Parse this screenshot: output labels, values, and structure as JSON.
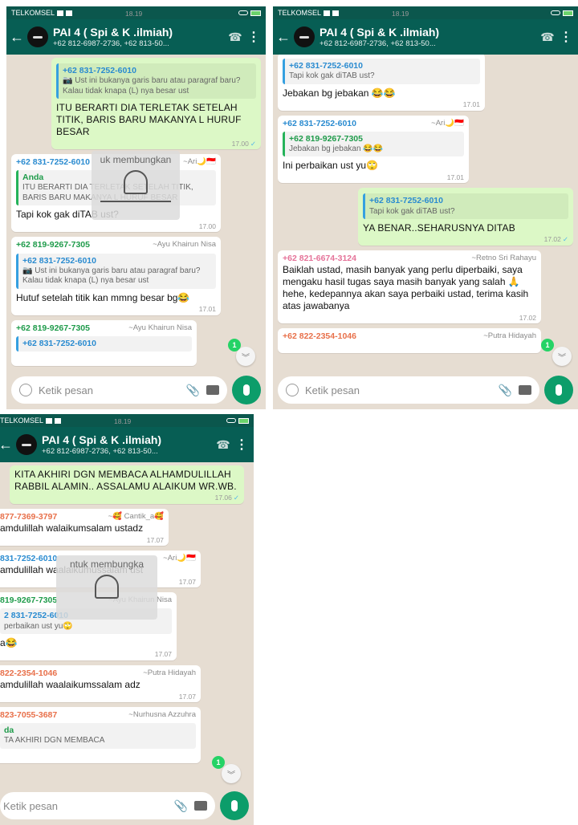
{
  "status": {
    "carrier": "TELKOMSEL",
    "time": "18.19"
  },
  "header": {
    "title": "PAI 4 ( Spi & K .ilmiah)",
    "subtitle": "+62 812-6987-2736, +62 813-50..."
  },
  "input": {
    "placeholder": "Ketik pesan"
  },
  "overlay": {
    "text1": "uk membungkan",
    "text3": "ntuk membungka"
  },
  "badges": {
    "unread": "1"
  },
  "p1": [
    {
      "name": "+62 831-7252-6010",
      "quote": "📷 Ust ini bukanya garis baru atau paragraf baru? Kalau tidak knapa (L) nya besar ust",
      "text": "ITU BERARTI DIA TERLETAK SETELAH TITIK, BARIS BARU MAKANYA L HURUF BESAR",
      "time": "17.00"
    },
    {
      "sender": "+62 831-7252-6010",
      "alias": "~Ari🌙🇮🇩",
      "qname": "Anda",
      "quote": "ITU BERARTI DIA TERLETAK SETELAH TITIK, BARIS BARU MAKANYA L HURUF BESAR",
      "text": "Tapi kok gak diTAB ust?",
      "time": "17.00"
    },
    {
      "sender": "+62 819-9267-7305",
      "alias": "~Ayu Khairun Nisa",
      "qname": "+62 831-7252-6010",
      "quote": "📷 Ust ini bukanya garis baru atau paragraf baru? Kalau tidak knapa (L) nya besar ust",
      "text": "Hutuf setelah titik kan mmng besar bg😂",
      "time": "17.01"
    },
    {
      "sender": "+62 819-9267-7305",
      "alias": "~Ayu Khairun Nisa",
      "qname": "+62 831-7252-6010"
    }
  ],
  "p2": [
    {
      "qname": "+62 831-7252-6010",
      "quote": "Tapi kok gak diTAB ust?",
      "text": "Jebakan bg jebakan 😂😂",
      "time": "17.01"
    },
    {
      "sender": "+62 831-7252-6010",
      "alias": "~Ari🌙🇮🇩",
      "qname": "+62 819-9267-7305",
      "quote": "Jebakan bg jebakan 😂😂",
      "text": "Ini perbaikan ust yu🙄",
      "time": "17.01"
    },
    {
      "qname": "+62 831-7252-6010",
      "quote": "Tapi kok gak diTAB ust?",
      "text": "YA BENAR..SEHARUSNYA DITAB",
      "time": "17.02"
    },
    {
      "sender": "+62 821-6674-3124",
      "alias": "~Retno Sri Rahayu",
      "text": "Baiklah ustad, masih banyak yang perlu diperbaiki, saya mengaku hasil tugas saya masih banyak yang salah 🙏 hehe, kedepannya akan saya perbaiki ustad, terima kasih atas jawabanya",
      "time": "17.02"
    },
    {
      "sender": "+62 822-2354-1046",
      "alias": "~Putra Hidayah"
    }
  ],
  "p3": [
    {
      "text": "KITA AKHIRI DGN MEMBACA ALHAMDULILLAH RABBIL ALAMIN.. ASSALAMU ALAIKUM WR.WB.",
      "time": "17.06"
    },
    {
      "sender": "877-7369-3797",
      "alias": "~🥰 Cantik_a🥰",
      "text": "amdulillah walaikumsalam ustadz",
      "time": "17.07"
    },
    {
      "sender": "831-7252-6010",
      "alias": "~Ari🌙🇮🇩",
      "text": "amdulillah waalaikumussalam ust",
      "time": "17.07"
    },
    {
      "sender": "819-9267-7305",
      "alias": "~Ayu Khairun Nisa",
      "qname": "2 831-7252-6010",
      "quote": "perbaikan ust yu🙄",
      "text": "a😂",
      "time": "17.07"
    },
    {
      "sender": "822-2354-1046",
      "alias": "~Putra Hidayah",
      "text": "amdulillah waalaikumssalam adz",
      "time": "17.07"
    },
    {
      "sender": "823-7055-3687",
      "alias": "~Nurhusna Azzuhra",
      "qname": "da",
      "quote": "TA AKHIRI DGN MEMBACA"
    }
  ],
  "colors": {
    "header": "#075e54",
    "outgoing": "#dcf8c6",
    "incoming": "#ffffff",
    "wallpaper": "#e6ddd2",
    "accent": "#0c9d6a"
  }
}
